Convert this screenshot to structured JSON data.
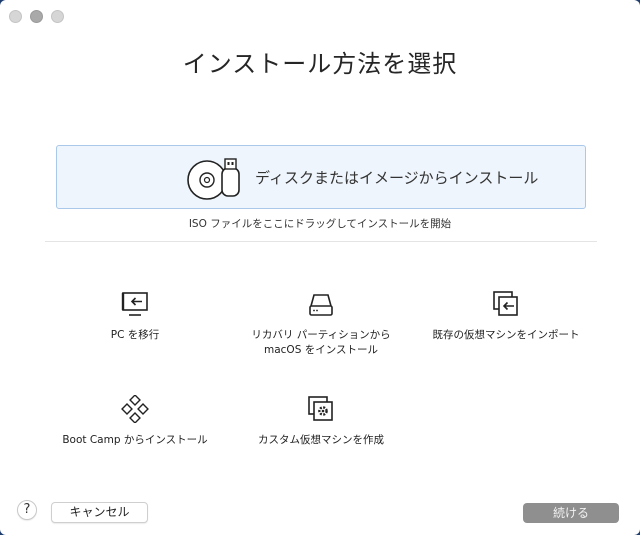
{
  "window": {
    "title": "インストール方法を選択"
  },
  "drop_area": {
    "label": "ディスクまたはイメージからインストール",
    "hint": "ISO ファイルをここにドラッグしてインストールを開始",
    "icon": "disc-usb-icon"
  },
  "options": [
    {
      "label_line1": "PC を移行",
      "label_line2": "",
      "icon": "migrate-pc-icon"
    },
    {
      "label_line1": "リカバリ パーティションから",
      "label_line2": "macOS をインストール",
      "icon": "drive-icon"
    },
    {
      "label_line1": "既存の仮想マシンをインポート",
      "label_line2": "",
      "icon": "import-vm-icon"
    },
    {
      "label_line1": "Boot Camp からインストール",
      "label_line2": "",
      "icon": "bootcamp-icon"
    },
    {
      "label_line1": "カスタム仮想マシンを作成",
      "label_line2": "",
      "icon": "custom-vm-icon"
    }
  ],
  "footer": {
    "help_label": "?",
    "cancel_label": "キャンセル",
    "continue_label": "続ける"
  }
}
